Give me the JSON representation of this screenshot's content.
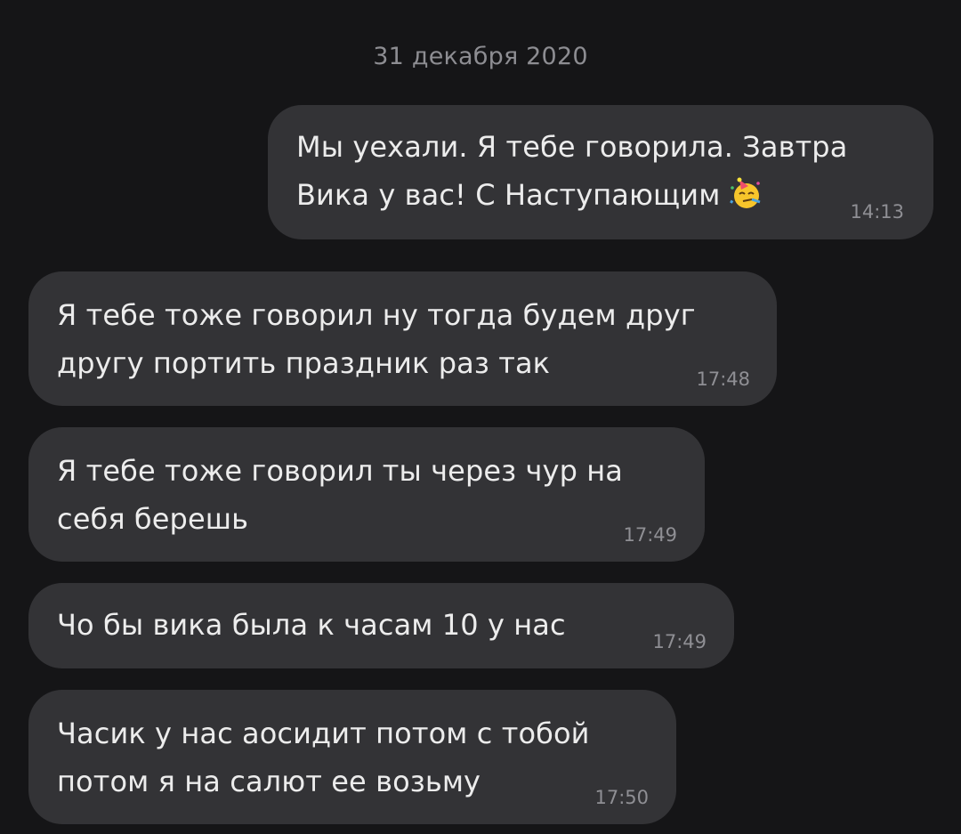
{
  "date_separator": "31 декабря 2020",
  "messages": [
    {
      "direction": "outgoing",
      "lines": [
        "Мы уехали. Я тебе говорила. Завтра",
        "Вика у вас! С Наступающим"
      ],
      "emoji": "partying-face-icon",
      "time": "14:13"
    },
    {
      "direction": "incoming",
      "lines": [
        "Я тебе тоже говорил ну тогда будем друг",
        "другу портить праздник раз так"
      ],
      "time": "17:48"
    },
    {
      "direction": "incoming",
      "lines": [
        "Я тебе тоже говорил ты через чур на",
        "себя берешь"
      ],
      "time": "17:49"
    },
    {
      "direction": "incoming",
      "lines": [
        "Чо бы вика была к часам 10 у нас"
      ],
      "time": "17:49"
    },
    {
      "direction": "incoming",
      "lines": [
        "Часик у нас аосидит потом с тобой",
        "потом я на салют ее возьму"
      ],
      "time": "17:50"
    }
  ],
  "colors": {
    "background": "#151517",
    "bubble": "#333336",
    "text": "#ececec",
    "timestamp": "#8f8f94"
  }
}
